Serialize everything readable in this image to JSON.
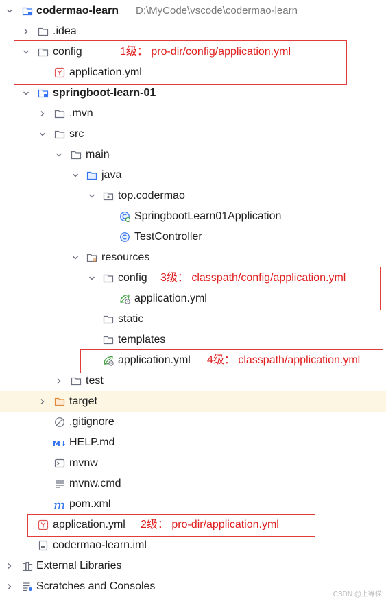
{
  "tree": {
    "root": {
      "name": "codermao-learn",
      "path": "D:\\MyCode\\vscode\\codermao-learn"
    },
    "idea": ".idea",
    "config": "config",
    "config_yml": "application.yml",
    "module": "springboot-learn-01",
    "mvn": ".mvn",
    "src": "src",
    "main": "main",
    "java": "java",
    "package": "top.codermao",
    "app_class": "SpringbootLearn01Application",
    "test_controller": "TestController",
    "resources": "resources",
    "res_config": "config",
    "res_config_yml": "application.yml",
    "static": "static",
    "templates": "templates",
    "res_yml": "application.yml",
    "test": "test",
    "target": "target",
    "gitignore": ".gitignore",
    "help": "HELP.md",
    "mvnw": "mvnw",
    "mvnw_cmd": "mvnw.cmd",
    "pom": "pom.xml",
    "root_yml": "application.yml",
    "iml": "codermao-learn.iml",
    "ext_libs": "External Libraries",
    "scratches": "Scratches and Consoles"
  },
  "annotations": {
    "level1": "1级： pro-dir/config/application.yml",
    "level2": "2级： pro-dir/application.yml",
    "level3": "3级： classpath/config/application.yml",
    "level4": "4级： classpath/application.yml"
  },
  "watermark": "CSDN @上等猫",
  "colors": {
    "annotation": "#e02020",
    "folder_stroke": "#6c707e",
    "source_folder": "#3574f0",
    "spring_green": "#3a9a3a",
    "yaml_red": "#e05555",
    "target_orange": "#e08a3c",
    "selected_row": "#fdf6e3"
  }
}
